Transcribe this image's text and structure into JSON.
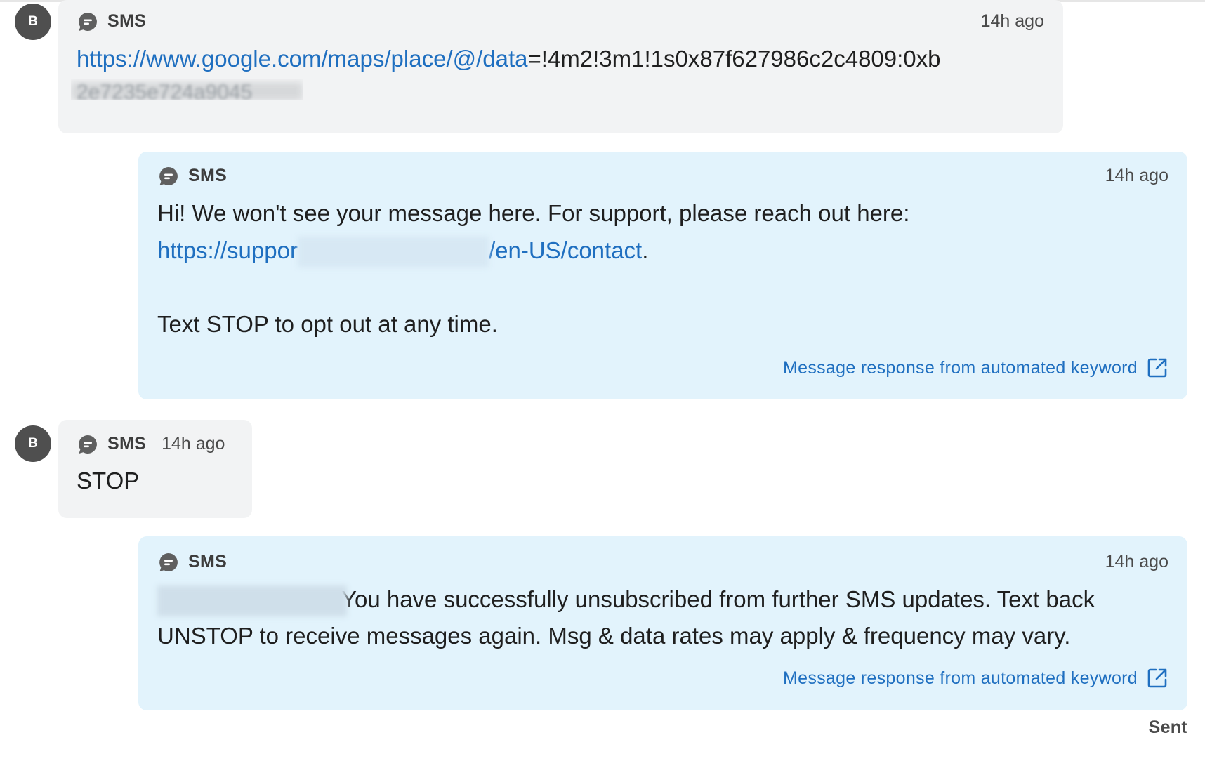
{
  "thread": {
    "messages": [
      {
        "direction": "inbound",
        "avatar": "B",
        "channel": "SMS",
        "time": "14h ago",
        "link": "https://www.google.com/maps/place/@/data",
        "text_rest": "=!4m2!3m1!1s0x87f627986c2c4809:0xb",
        "text_line2": "2e7235e724a9045"
      },
      {
        "direction": "outbound",
        "channel": "SMS",
        "time": "14h ago",
        "line1": "Hi! We won't see your message here. For support, please reach out here:",
        "link_start": "https://suppor",
        "link_end": "/en-US/contact",
        "after_link": ".",
        "line3": "Text STOP to opt out at any time.",
        "automated": "Message response from automated keyword"
      },
      {
        "direction": "inbound",
        "avatar": "B",
        "channel": "SMS",
        "time": "14h ago",
        "text": "STOP"
      },
      {
        "direction": "outbound",
        "channel": "SMS",
        "time": "14h ago",
        "line1": "You have successfully unsubscribed from further SMS updates. Text back",
        "line2": "UNSTOP to receive messages again. Msg & data rates may apply & frequency may vary.",
        "automated": "Message response from automated keyword"
      }
    ],
    "status": "Sent"
  },
  "icons": {
    "channel": "sms-bubble-icon",
    "external": "external-link-icon"
  },
  "colors": {
    "inbound_bg": "#f2f3f4",
    "outbound_bg": "#e2f3fc",
    "link": "#1f6fc0",
    "avatar_bg": "#4f4f4f"
  }
}
